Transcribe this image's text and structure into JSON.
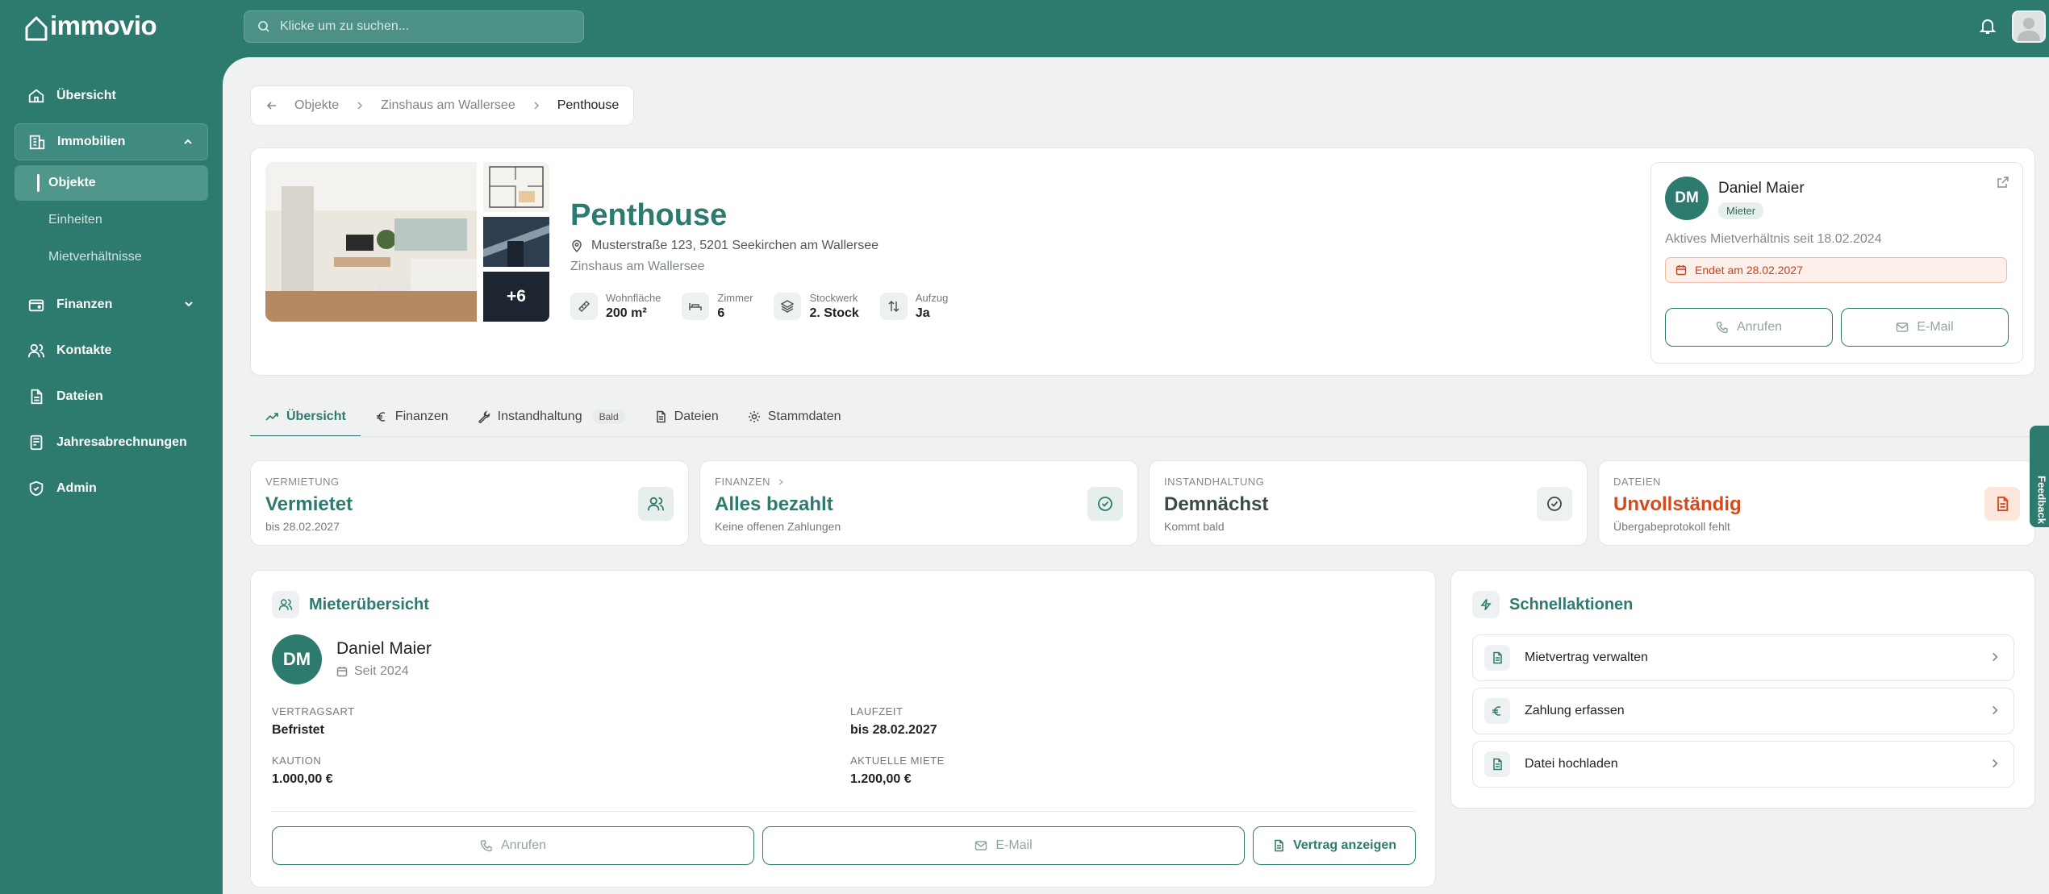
{
  "app": {
    "logo": "immovio"
  },
  "search": {
    "placeholder": "Klicke um zu suchen..."
  },
  "sidebar": {
    "items": [
      {
        "label": "Übersicht",
        "icon": "home-icon"
      },
      {
        "label": "Immobilien",
        "icon": "building-icon"
      },
      {
        "label": "Finanzen",
        "icon": "wallet-icon"
      },
      {
        "label": "Kontakte",
        "icon": "users-icon"
      },
      {
        "label": "Dateien",
        "icon": "file-icon"
      },
      {
        "label": "Jahresabrechnungen",
        "icon": "receipt-icon"
      },
      {
        "label": "Admin",
        "icon": "shield-icon"
      }
    ],
    "sub_items": [
      {
        "label": "Objekte"
      },
      {
        "label": "Einheiten"
      },
      {
        "label": "Mietverhältnisse"
      }
    ]
  },
  "breadcrumb": {
    "items": [
      "Objekte",
      "Zinshaus am Wallersee",
      "Penthouse"
    ]
  },
  "property": {
    "title": "Penthouse",
    "address": "Musterstraße 123, 5201 Seekirchen am Wallersee",
    "building": "Zinshaus am Wallersee",
    "more_photos": "+6",
    "facts": [
      {
        "label": "Wohnfläche",
        "value": "200 m²",
        "icon": "ruler-icon"
      },
      {
        "label": "Zimmer",
        "value": "6",
        "icon": "bed-icon"
      },
      {
        "label": "Stockwerk",
        "value": "2. Stock",
        "icon": "layers-icon"
      },
      {
        "label": "Aufzug",
        "value": "Ja",
        "icon": "elevator-icon"
      }
    ]
  },
  "tenant": {
    "initials": "DM",
    "name": "Daniel Maier",
    "role": "Mieter",
    "active_since": "Aktives Mietverhältnis seit 18.02.2024",
    "ends": "Endet am 28.02.2027",
    "call_label": "Anrufen",
    "email_label": "E-Mail"
  },
  "tabs": [
    {
      "label": "Übersicht",
      "icon": "trend-icon"
    },
    {
      "label": "Finanzen",
      "icon": "euro-icon"
    },
    {
      "label": "Instandhaltung",
      "icon": "wrench-icon",
      "badge": "Bald"
    },
    {
      "label": "Dateien",
      "icon": "file-icon"
    },
    {
      "label": "Stammdaten",
      "icon": "gear-icon"
    }
  ],
  "stats": [
    {
      "label": "VERMIETUNG",
      "value": "Vermietet",
      "sub": "bis 28.02.2027",
      "color": "#2d7a6e"
    },
    {
      "label": "FINANZEN",
      "value": "Alles bezahlt",
      "sub": "Keine offenen Zahlungen",
      "color": "#2d7a6e"
    },
    {
      "label": "INSTANDHALTUNG",
      "value": "Demnächst",
      "sub": "Kommt bald",
      "color": "#3a4a4a"
    },
    {
      "label": "DATEIEN",
      "value": "Unvollständig",
      "sub": "Übergabeprotokoll fehlt",
      "color": "#d44a1c"
    }
  ],
  "feedback": {
    "label": "Feedback"
  },
  "tenant_overview": {
    "title": "Mieterübersicht",
    "initials": "DM",
    "name": "Daniel Maier",
    "since": "Seit 2024",
    "fields": [
      {
        "label": "VERTRAGSART",
        "value": "Befristet"
      },
      {
        "label": "LAUFZEIT",
        "value": "bis 28.02.2027"
      },
      {
        "label": "KAUTION",
        "value": "1.000,00 €"
      },
      {
        "label": "AKTUELLE MIETE",
        "value": "1.200,00 €"
      }
    ],
    "call_label": "Anrufen",
    "email_label": "E-Mail",
    "contract_label": "Vertrag anzeigen"
  },
  "quick_actions": {
    "title": "Schnellaktionen",
    "items": [
      {
        "label": "Mietvertrag verwalten",
        "icon": "document-icon"
      },
      {
        "label": "Zahlung erfassen",
        "icon": "euro-icon"
      },
      {
        "label": "Datei hochladen",
        "icon": "upload-file-icon"
      }
    ]
  }
}
